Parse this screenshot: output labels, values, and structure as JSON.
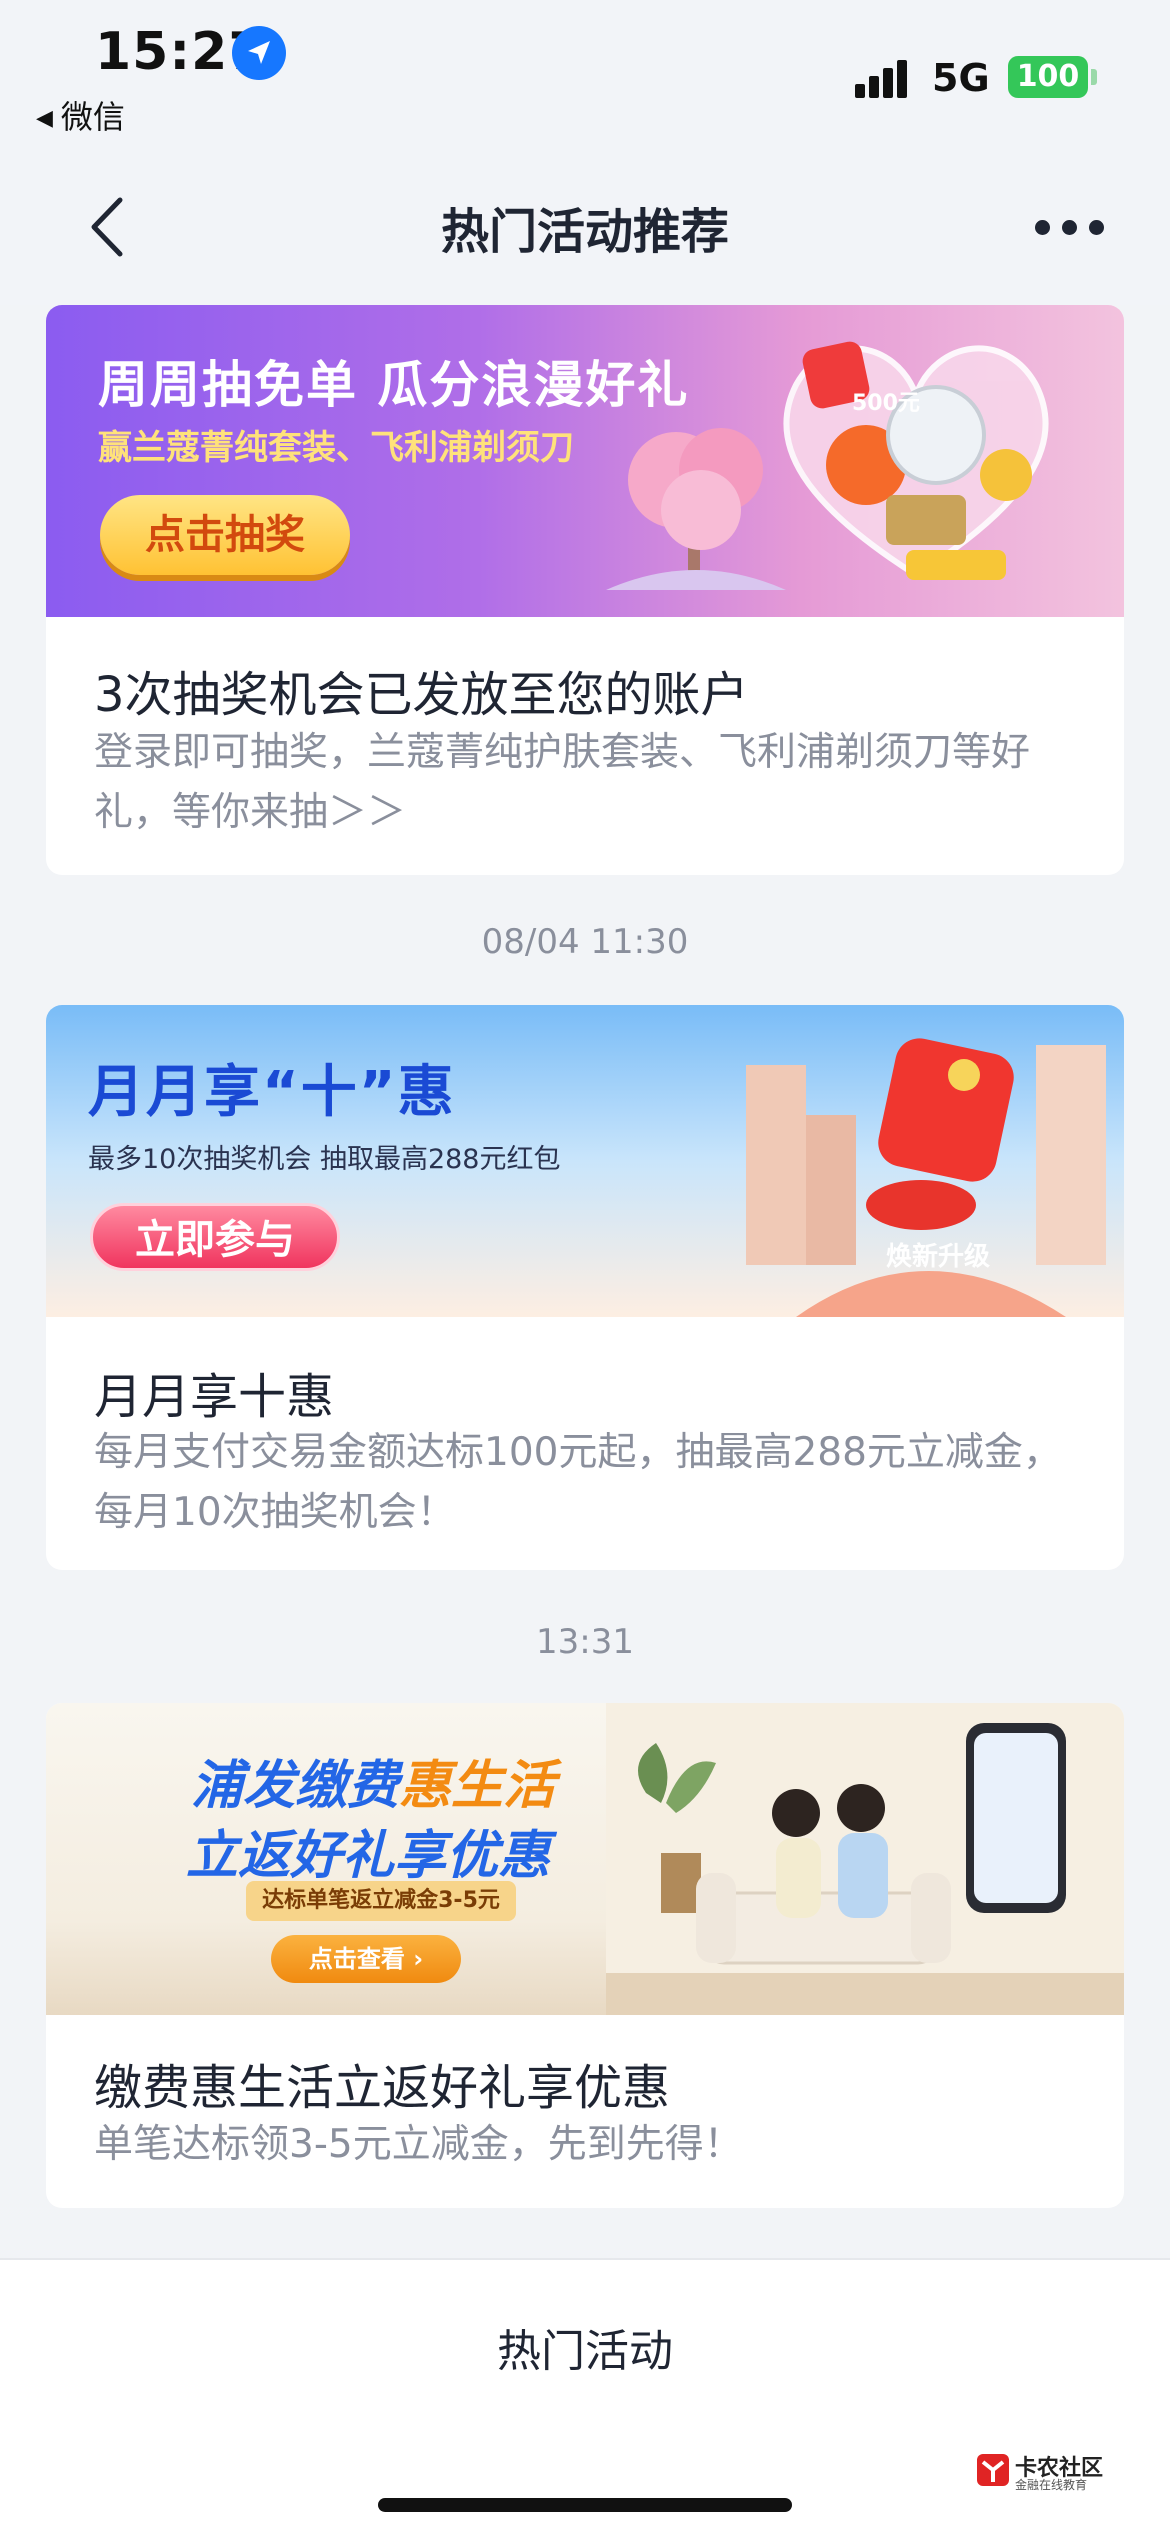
{
  "status_bar": {
    "time": "15:27",
    "back_app": "微信",
    "network": "5G",
    "battery": "100"
  },
  "nav": {
    "title": "热门活动推荐"
  },
  "feed": [
    {
      "banner": {
        "headline": "周周抽免单 瓜分浪漫好礼",
        "subline": "赢兰蔻菁纯套装、飞利浦剃须刀",
        "button": "点击抽奖",
        "coin_label": "500元"
      },
      "title": "3次抽奖机会已发放至您的账户",
      "description": "登录即可抽奖，兰蔻菁纯护肤套装、飞利浦剃须刀等好礼，等你来抽＞＞"
    },
    {
      "timestamp": "08/04 11:30",
      "banner": {
        "headline": "月月享“十”惠",
        "subline": "最多10次抽奖机会 抽取最高288元红包",
        "button": "立即参与",
        "sign_text": "焕新升级"
      },
      "title": "月月享十惠",
      "description": "每月支付交易金额达标100元起，抽最高288元立减金，每月10次抽奖机会！"
    },
    {
      "timestamp": "13:31",
      "banner": {
        "headline_part1": "浦发缴费",
        "headline_highlight": "惠生活",
        "headline_line2": "立返好礼享优惠",
        "tag": "达标单笔返立减金3-5元",
        "button": "点击查看 ›"
      },
      "title": "缴费惠生活立返好礼享优惠",
      "description": "单笔达标领3-5元立减金，先到先得！"
    }
  ],
  "bottom_tab": {
    "label": "热门活动"
  },
  "watermark": {
    "name": "卡农社区",
    "sub": "金融在线教育"
  },
  "colors": {
    "accent_blue": "#1677ff",
    "battery_green": "#34c759",
    "title_text": "#1f2533",
    "secondary_text": "#8a8f9c"
  }
}
